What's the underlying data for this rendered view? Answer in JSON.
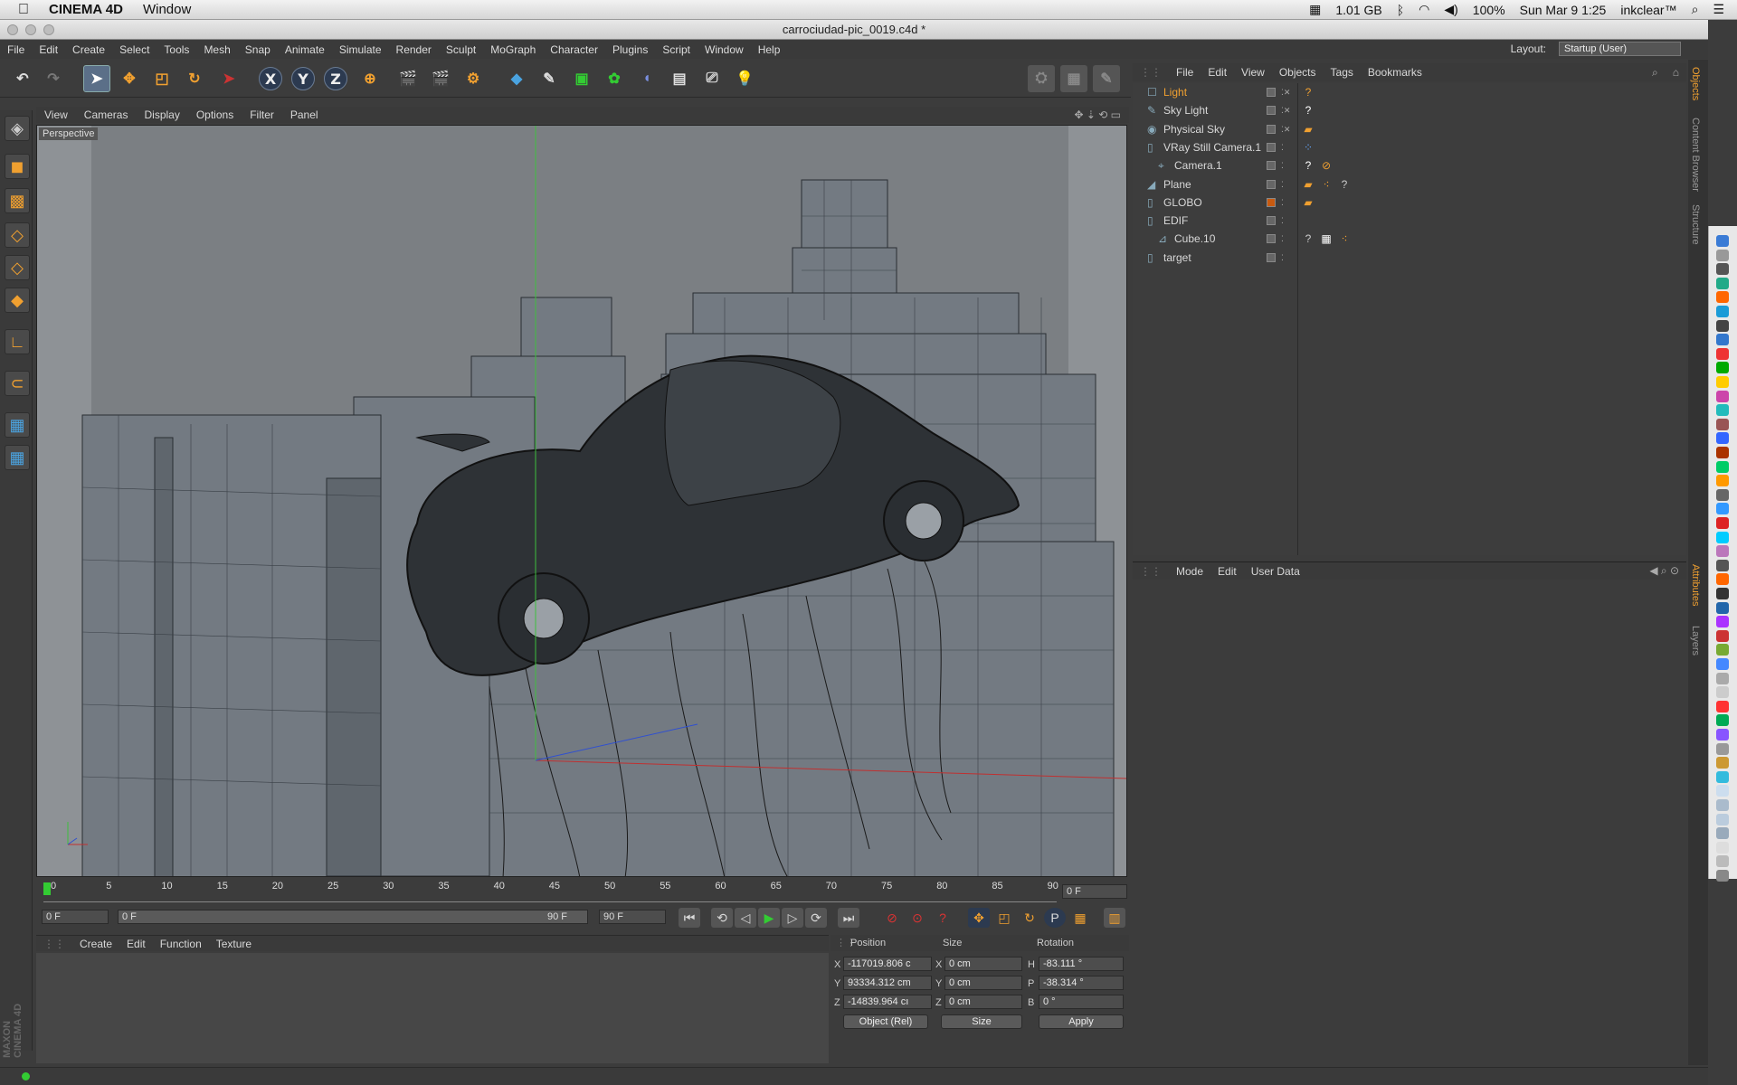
{
  "mac_menubar": {
    "app_name": "CINEMA 4D",
    "menu": "Window",
    "memory": "1.01 GB",
    "battery": "100%",
    "datetime": "Sun Mar 9  1:25",
    "user": "inkclear™"
  },
  "window": {
    "title": "carrociudad-pic_0019.c4d *"
  },
  "menubar": {
    "items": [
      "File",
      "Edit",
      "Create",
      "Select",
      "Tools",
      "Mesh",
      "Snap",
      "Animate",
      "Simulate",
      "Render",
      "Sculpt",
      "MoGraph",
      "Character",
      "Plugins",
      "Script",
      "Window",
      "Help"
    ],
    "layout_label": "Layout:",
    "layout_value": "Startup (User)"
  },
  "toolbar": {
    "axis_x": "X",
    "axis_y": "Y",
    "axis_z": "Z"
  },
  "viewport": {
    "menu": [
      "View",
      "Cameras",
      "Display",
      "Options",
      "Filter",
      "Panel"
    ],
    "label": "Perspective"
  },
  "timeline": {
    "ticks": [
      "0",
      "5",
      "10",
      "15",
      "20",
      "25",
      "30",
      "35",
      "40",
      "45",
      "50",
      "55",
      "60",
      "65",
      "70",
      "75",
      "80",
      "85",
      "90"
    ],
    "current_frame": "0 F",
    "start_field": "0 F",
    "range_start": "0 F",
    "range_end": "90 F",
    "end_field": "90 F"
  },
  "materials": {
    "menu": [
      "Create",
      "Edit",
      "Function",
      "Texture"
    ]
  },
  "coordinates": {
    "headers": {
      "position": "Position",
      "size": "Size",
      "rotation": "Rotation"
    },
    "rows": [
      {
        "axis": "X",
        "pos": "-117019.806 c",
        "size_axis": "X",
        "size": "0 cm",
        "rot_axis": "H",
        "rot": "-83.111 °"
      },
      {
        "axis": "Y",
        "pos": "93334.312 cm",
        "size_axis": "Y",
        "size": "0 cm",
        "rot_axis": "P",
        "rot": "-38.314 °"
      },
      {
        "axis": "Z",
        "pos": "-14839.964 cı",
        "size_axis": "Z",
        "size": "0 cm",
        "rot_axis": "B",
        "rot": "0 °"
      }
    ],
    "mode_select": "Object (Rel)",
    "size_select": "Size",
    "apply": "Apply"
  },
  "objects": {
    "menu": [
      "File",
      "Edit",
      "View",
      "Objects",
      "Tags",
      "Bookmarks"
    ],
    "items": [
      {
        "name": "Light",
        "indent": 0
      },
      {
        "name": "Sky Light",
        "indent": 0
      },
      {
        "name": "Physical Sky",
        "indent": 0
      },
      {
        "name": "VRay Still Camera.1",
        "indent": 0
      },
      {
        "name": "Camera.1",
        "indent": 1
      },
      {
        "name": "Plane",
        "indent": 0
      },
      {
        "name": "GLOBO",
        "indent": 0
      },
      {
        "name": "EDIF",
        "indent": 0
      },
      {
        "name": "Cube.10",
        "indent": 1
      },
      {
        "name": "target",
        "indent": 0
      }
    ],
    "selected_color": "#f0a030"
  },
  "attributes": {
    "menu": [
      "Mode",
      "Edit",
      "User Data"
    ]
  },
  "right_tabs": [
    "Objects",
    "Content Browser",
    "Structure",
    "Attributes",
    "Layers"
  ],
  "branding": {
    "maxon": "MAXON CINEMA 4D"
  }
}
